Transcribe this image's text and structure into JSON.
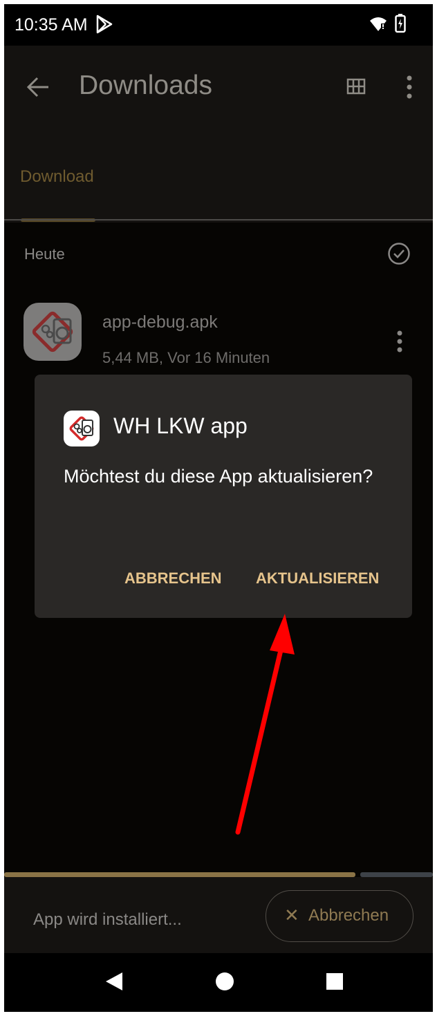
{
  "status_bar": {
    "time": "10:35 AM"
  },
  "app_bar": {
    "title": "Downloads"
  },
  "tabs": [
    {
      "label": "Download",
      "selected": true
    }
  ],
  "list": {
    "section_title": "Heute",
    "items": [
      {
        "name": "app-debug.apk",
        "meta": "5,44 MB, Vor 16 Minuten"
      }
    ]
  },
  "dialog": {
    "title": "WH LKW app",
    "message": "Möchtest du diese App aktualisieren?",
    "cancel_label": "ABBRECHEN",
    "confirm_label": "AKTUALISIEREN"
  },
  "install_bar": {
    "status_text": "App wird installiert...",
    "cancel_label": "Abbrechen",
    "progress": 0.82
  },
  "colors": {
    "accent": "#e6c48c",
    "dialog_bg": "#2a2826",
    "annotation_arrow": "#ff0000"
  },
  "icons": [
    "play-store-icon",
    "wifi-icon",
    "battery-icon",
    "back-arrow-icon",
    "grid-view-icon",
    "more-vert-icon",
    "check-circle-icon",
    "app-icon",
    "close-icon",
    "nav-back-icon",
    "nav-home-icon",
    "nav-recents-icon"
  ]
}
